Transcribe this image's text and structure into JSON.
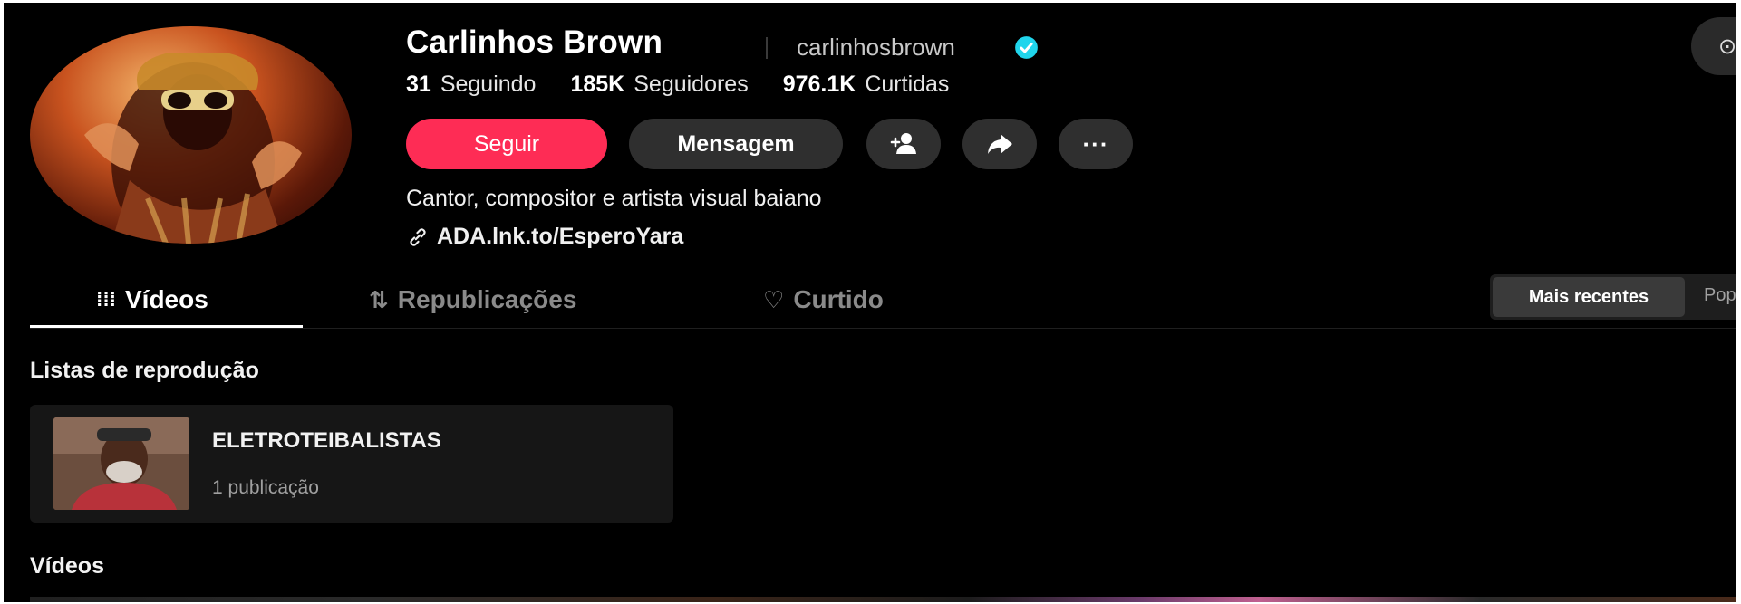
{
  "profile": {
    "display_name": "Carlinhos Brown",
    "username": "carlinhosbrown",
    "verified_icon": "verified-badge-icon",
    "stats": [
      {
        "value": "31",
        "label": "Seguindo"
      },
      {
        "value": "185K",
        "label": "Seguidores"
      },
      {
        "value": "976.1K",
        "label": "Curtidas"
      }
    ],
    "bio": "Cantor, compositor e artista visual baiano",
    "link": "ADA.lnk.to/EsperoYara"
  },
  "actions": {
    "follow_label": "Seguir",
    "message_label": "Mensagem",
    "add_friend_icon": "add-user-icon",
    "share_icon": "share-arrow-icon",
    "more_icon": "more-dots-icon",
    "more_label": "···"
  },
  "corner": {
    "label": "⊙"
  },
  "tabs": [
    {
      "label": "Vídeos",
      "icon": "grid-icon",
      "glyph": "⁞⁞⁞",
      "active": true
    },
    {
      "label": "Republicações",
      "icon": "repost-icon",
      "glyph": "⇅",
      "active": false
    },
    {
      "label": "Curtido",
      "icon": "heart-icon",
      "glyph": "♡",
      "active": false
    }
  ],
  "sort": {
    "active": "Mais recentes",
    "inactive": "Pop"
  },
  "sections": {
    "playlists_title": "Listas de reprodução",
    "videos_title": "Vídeos"
  },
  "playlist": {
    "title": "ELETROTEIBALISTAS",
    "count": "1 publicação"
  },
  "colors": {
    "background": "#000000",
    "accent": "#fe2c55",
    "button_gray": "#2f2f2f",
    "verified": "#20d5ec"
  }
}
